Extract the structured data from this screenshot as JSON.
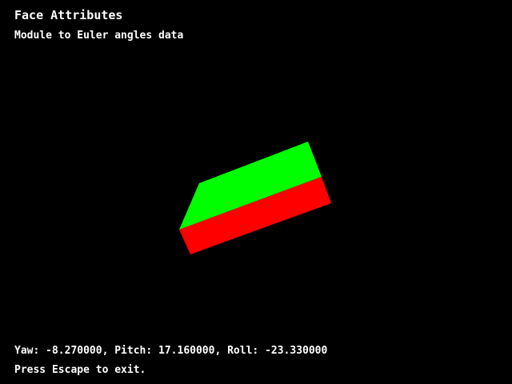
{
  "window": {
    "title": "Face Attributes",
    "subtitle": "Module to Euler angles data"
  },
  "pose": {
    "status_line": "Yaw: -8.270000, Pitch: 17.160000, Roll: -23.330000",
    "yaw": -8.27,
    "pitch": 17.16,
    "roll": -23.33
  },
  "instructions": {
    "exit_hint": "Press Escape to exit."
  },
  "colors": {
    "background": "#000000",
    "top_face": "#00ff00",
    "front_face": "#ff0000",
    "text": "#ffffff"
  }
}
